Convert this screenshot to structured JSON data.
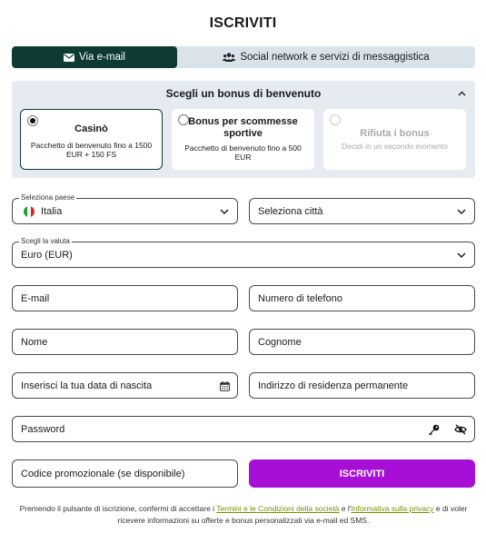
{
  "title": "ISCRIVITI",
  "tabs": [
    {
      "label": "Via e-mail"
    },
    {
      "label": "Social network e servizi di messaggistica"
    }
  ],
  "bonus": {
    "heading": "Scegli un bonus di benvenuto",
    "options": [
      {
        "name": "Casinò",
        "desc": "Pacchetto di benvenuto fino a 1500 EUR + 150 FS",
        "selected": true
      },
      {
        "name": "Bonus per scommesse sportive",
        "desc": "Pacchetto di benvenuto fino a 500 EUR",
        "selected": false
      },
      {
        "name": "Rifiuta i bonus",
        "desc": "Decidi in un secondo momento",
        "selected": false
      }
    ]
  },
  "form": {
    "country": {
      "label": "Seleziona paese",
      "value": "Italia"
    },
    "city": {
      "placeholder": "Seleziona città"
    },
    "currency": {
      "label": "Scegli la valuta",
      "value": "Euro (EUR)"
    },
    "email": {
      "placeholder": "E-mail"
    },
    "phone": {
      "placeholder": "Numero di telefono"
    },
    "first_name": {
      "placeholder": "Nome"
    },
    "last_name": {
      "placeholder": "Cognome"
    },
    "birthdate": {
      "placeholder": "Inserisci la tua data di nascita"
    },
    "address": {
      "placeholder": "Indirizzo di residenza permanente"
    },
    "password": {
      "placeholder": "Password"
    },
    "promo": {
      "placeholder": "Codice promozionale (se disponibile)"
    },
    "submit_label": "ISCRIVITI"
  },
  "terms": {
    "prefix": "Premendo il pulsante di iscrizione, confermi di accettare i ",
    "link1": "Termini e le Condizioni della società",
    "mid": " e l'",
    "link2": "Informativa sulla privacy",
    "suffix": " e di voler ricevere informazioni su offerte e bonus personalizzati via e-mail ed SMS."
  },
  "colors": {
    "tab_active": "#0d3a32",
    "submit": "#a70fd6",
    "link": "#7a8f00",
    "panel": "#e5ebf1"
  },
  "icons": [
    "envelope-icon",
    "users-icon",
    "chevron-up-icon",
    "chevron-down-icon",
    "italy-flag-icon",
    "calendar-icon",
    "key-icon",
    "eye-off-icon"
  ]
}
